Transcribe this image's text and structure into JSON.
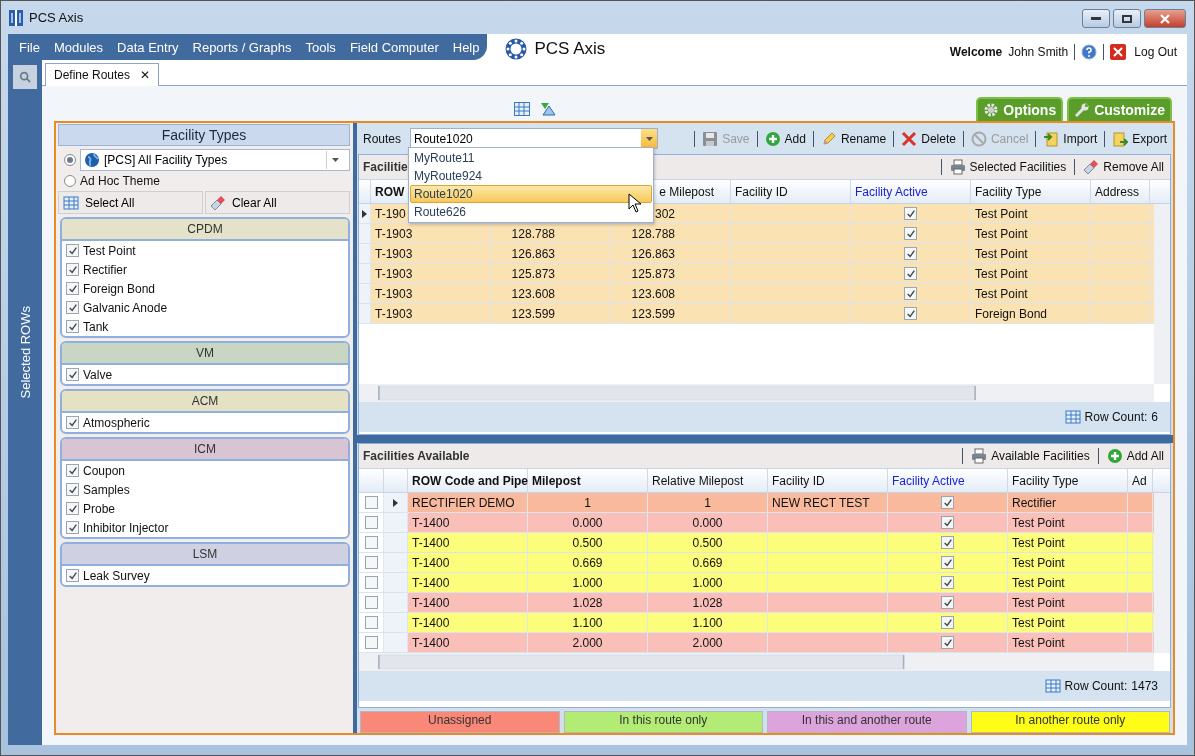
{
  "window": {
    "title": "PCS Axis"
  },
  "menu": [
    "File",
    "Modules",
    "Data Entry",
    "Reports / Graphs",
    "Tools",
    "Field Computer",
    "Help"
  ],
  "brand": "PCS Axis",
  "user": {
    "greeting": "Welcome",
    "name": "John Smith",
    "logout": "Log Out"
  },
  "side_tab": "Selected ROWs",
  "tabs": [
    {
      "label": "Define Routes",
      "selected": true,
      "close": "✕"
    }
  ],
  "view_buttons": [
    {
      "label": "Options",
      "kind": "gear"
    },
    {
      "label": "Customize",
      "kind": "wrench"
    }
  ],
  "facility_types": {
    "title": "Facility Types",
    "theme_options": [
      {
        "label": "[PCS] All Facility Types",
        "selected": true,
        "kind": "dropdown"
      },
      {
        "label": "Ad Hoc Theme",
        "selected": false,
        "kind": "plain"
      }
    ],
    "buttons": [
      {
        "label": "Select All",
        "kind": "grid"
      },
      {
        "label": "Clear All",
        "kind": "eraser"
      }
    ],
    "groups": [
      {
        "name": "CPDM",
        "color": "#e4e2c8",
        "items": [
          {
            "label": "Test Point",
            "checked": true
          },
          {
            "label": "Rectifier",
            "checked": true
          },
          {
            "label": "Foreign Bond",
            "checked": true
          },
          {
            "label": "Galvanic Anode",
            "checked": true
          },
          {
            "label": "Tank",
            "checked": true
          }
        ]
      },
      {
        "name": "VM",
        "color": "#c9d6c4",
        "items": [
          {
            "label": "Valve",
            "checked": true
          }
        ]
      },
      {
        "name": "ACM",
        "color": "#e4e1c4",
        "items": [
          {
            "label": "Atmospheric",
            "checked": true
          }
        ]
      },
      {
        "name": "ICM",
        "color": "#d9c4d3",
        "items": [
          {
            "label": "Coupon",
            "checked": true
          },
          {
            "label": "Samples",
            "checked": true
          },
          {
            "label": "Probe",
            "checked": true
          },
          {
            "label": "Inhibitor Injector",
            "checked": true
          }
        ]
      },
      {
        "name": "LSM",
        "color": "#d0d0e3",
        "items": [
          {
            "label": "Leak Survey",
            "checked": true
          }
        ]
      }
    ]
  },
  "routes": {
    "label": "Routes",
    "value": "Route1020",
    "expanded": true,
    "options": [
      {
        "label": "MyRoute11",
        "selected": false
      },
      {
        "label": "MyRoute924",
        "selected": false
      },
      {
        "label": "Route1020",
        "selected": true
      },
      {
        "label": "Route626",
        "selected": false
      }
    ],
    "toolbar": [
      {
        "label": "Save",
        "kind": "save",
        "disabled": true
      },
      {
        "label": "Add",
        "kind": "add",
        "disabled": false
      },
      {
        "label": "Rename",
        "kind": "rename",
        "disabled": false
      },
      {
        "label": "Delete",
        "kind": "delete",
        "disabled": false
      },
      {
        "label": "Cancel",
        "kind": "cancel",
        "disabled": true
      },
      {
        "label": "Import",
        "kind": "import",
        "disabled": false
      },
      {
        "label": "Export",
        "kind": "export",
        "disabled": false
      }
    ]
  },
  "selected_grid": {
    "title": "Facilitie",
    "actions": [
      {
        "label": "Selected Facilities",
        "kind": "print"
      },
      {
        "label": "Remove All",
        "kind": "eraser"
      }
    ],
    "columns": [
      {
        "label": "ROW",
        "bold": true
      },
      {},
      {
        "label": "e Milepost",
        "bold": false
      },
      {
        "label": "Facility ID",
        "bold": false
      },
      {
        "label": "Facility Active",
        "bold": false,
        "kind": "check"
      },
      {
        "label": "Facility Type",
        "bold": false
      },
      {
        "label": "Address",
        "bold": false
      }
    ],
    "rows": [
      {
        "current": true,
        "color": "#fbe2b3",
        "row_code": "T-190",
        "relative_milepost": "302",
        "active": true,
        "facility_type": "Test Point"
      },
      {
        "current": false,
        "color": "#fbe2b3",
        "row_code": "T-1903",
        "milepost": "128.788",
        "relative_milepost": "128.788",
        "active": true,
        "facility_type": "Test Point"
      },
      {
        "current": false,
        "color": "#fbe2b3",
        "row_code": "T-1903",
        "milepost": "126.863",
        "relative_milepost": "126.863",
        "active": true,
        "facility_type": "Test Point"
      },
      {
        "current": false,
        "color": "#fbe2b3",
        "row_code": "T-1903",
        "milepost": "125.873",
        "relative_milepost": "125.873",
        "active": true,
        "facility_type": "Test Point"
      },
      {
        "current": false,
        "color": "#fbe2b3",
        "row_code": "T-1903",
        "milepost": "123.608",
        "relative_milepost": "123.608",
        "active": true,
        "facility_type": "Test Point"
      },
      {
        "current": false,
        "color": "#fbe2b3",
        "row_code": "T-1903",
        "milepost": "123.599",
        "relative_milepost": "123.599",
        "active": true,
        "facility_type": "Foreign Bond"
      }
    ],
    "row_count_label": "Row Count:",
    "row_count": "6"
  },
  "available_grid": {
    "title": "Facilities Available",
    "actions": [
      {
        "label": "Available Facilities",
        "kind": "print"
      },
      {
        "label": "Add All",
        "kind": "add"
      }
    ],
    "columns": [
      {
        "label": "ROW Code and Pipe",
        "bold": true
      },
      {
        "label": "Milepost",
        "bold": true
      },
      {
        "label": "Relative Milepost",
        "bold": false
      },
      {
        "label": "Facility ID",
        "bold": false
      },
      {
        "label": "Facility Active",
        "bold": false,
        "kind": "check"
      },
      {
        "label": "Facility Type",
        "bold": false
      },
      {
        "label": "Ad",
        "bold": false
      }
    ],
    "rows": [
      {
        "checked": false,
        "current": true,
        "color": "#f8b99c",
        "row_code": "RECTIFIER DEMO",
        "milepost": "1",
        "relative_milepost": "1",
        "facility_id": "NEW RECT TEST",
        "active": true,
        "facility_type": "Rectifier"
      },
      {
        "checked": false,
        "current": false,
        "color": "#fbbfba",
        "row_code": "T-1400",
        "milepost": "0.000",
        "relative_milepost": "0.000",
        "active": true,
        "facility_type": "Test Point"
      },
      {
        "checked": false,
        "current": false,
        "color": "#fdfd7c",
        "row_code": "T-1400",
        "milepost": "0.500",
        "relative_milepost": "0.500",
        "active": true,
        "facility_type": "Test Point"
      },
      {
        "checked": false,
        "current": false,
        "color": "#fdfd7c",
        "row_code": "T-1400",
        "milepost": "0.669",
        "relative_milepost": "0.669",
        "active": true,
        "facility_type": "Test Point"
      },
      {
        "checked": false,
        "current": false,
        "color": "#fdfd7c",
        "row_code": "T-1400",
        "milepost": "1.000",
        "relative_milepost": "1.000",
        "active": true,
        "facility_type": "Test Point"
      },
      {
        "checked": false,
        "current": false,
        "color": "#fbbfba",
        "row_code": "T-1400",
        "milepost": "1.028",
        "relative_milepost": "1.028",
        "active": true,
        "facility_type": "Test Point"
      },
      {
        "checked": false,
        "current": false,
        "color": "#fdfd7c",
        "row_code": "T-1400",
        "milepost": "1.100",
        "relative_milepost": "1.100",
        "active": true,
        "facility_type": "Test Point"
      },
      {
        "checked": false,
        "current": false,
        "color": "#fbbfba",
        "row_code": "T-1400",
        "milepost": "2.000",
        "relative_milepost": "2.000",
        "active": true,
        "facility_type": "Test Point"
      }
    ],
    "row_count_label": "Row Count:",
    "row_count": "1473"
  },
  "legend": [
    {
      "label": "Unassigned",
      "color": "#fa8878"
    },
    {
      "label": "In this route only",
      "color": "#b3ec74"
    },
    {
      "label": "In this and another route",
      "color": "#dda3dc"
    },
    {
      "label": "In another route only",
      "color": "#fdfd18"
    }
  ]
}
